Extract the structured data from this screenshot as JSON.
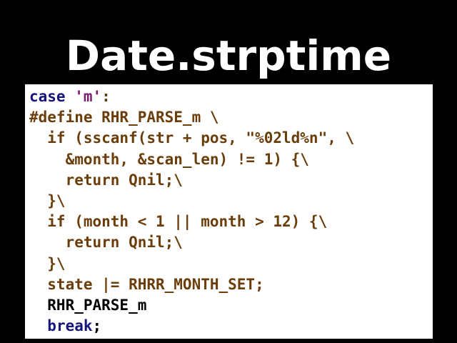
{
  "slide": {
    "title": "Date.strptime"
  },
  "code": {
    "colors": {
      "keyword": "#16167a",
      "string": "#7a1a6e",
      "preprocessor": "#6b3d0a",
      "text": "#5c3a0c"
    },
    "lines": [
      {
        "segments": [
          {
            "text": "case",
            "style": "keyword"
          },
          {
            "text": " ",
            "style": "text"
          },
          {
            "text": "'m'",
            "style": "string"
          },
          {
            "text": ":",
            "style": "text"
          }
        ]
      },
      {
        "segments": [
          {
            "text": "#define RHR_PARSE_m \\",
            "style": "preprocessor"
          }
        ]
      },
      {
        "segments": [
          {
            "text": "  if (sscanf(str + pos, \"%02ld%n\", \\",
            "style": "preprocessor"
          }
        ]
      },
      {
        "segments": [
          {
            "text": "    &month, &scan_len) != 1) {\\",
            "style": "preprocessor"
          }
        ]
      },
      {
        "segments": [
          {
            "text": "    return Qnil;\\",
            "style": "preprocessor"
          }
        ]
      },
      {
        "segments": [
          {
            "text": "  }\\",
            "style": "preprocessor"
          }
        ]
      },
      {
        "segments": [
          {
            "text": "  if (month < 1 || month > 12) {\\",
            "style": "preprocessor"
          }
        ]
      },
      {
        "segments": [
          {
            "text": "    return Qnil;\\",
            "style": "preprocessor"
          }
        ]
      },
      {
        "segments": [
          {
            "text": "  }\\",
            "style": "preprocessor"
          }
        ]
      },
      {
        "segments": [
          {
            "text": "  state |= RHRR_MONTH_SET;",
            "style": "preprocessor"
          }
        ]
      },
      {
        "segments": [
          {
            "text": "  RHR_PARSE_m",
            "style": "black"
          }
        ]
      },
      {
        "segments": [
          {
            "text": "  ",
            "style": "text"
          },
          {
            "text": "break",
            "style": "keyword"
          },
          {
            "text": ";",
            "style": "black"
          }
        ]
      }
    ]
  }
}
